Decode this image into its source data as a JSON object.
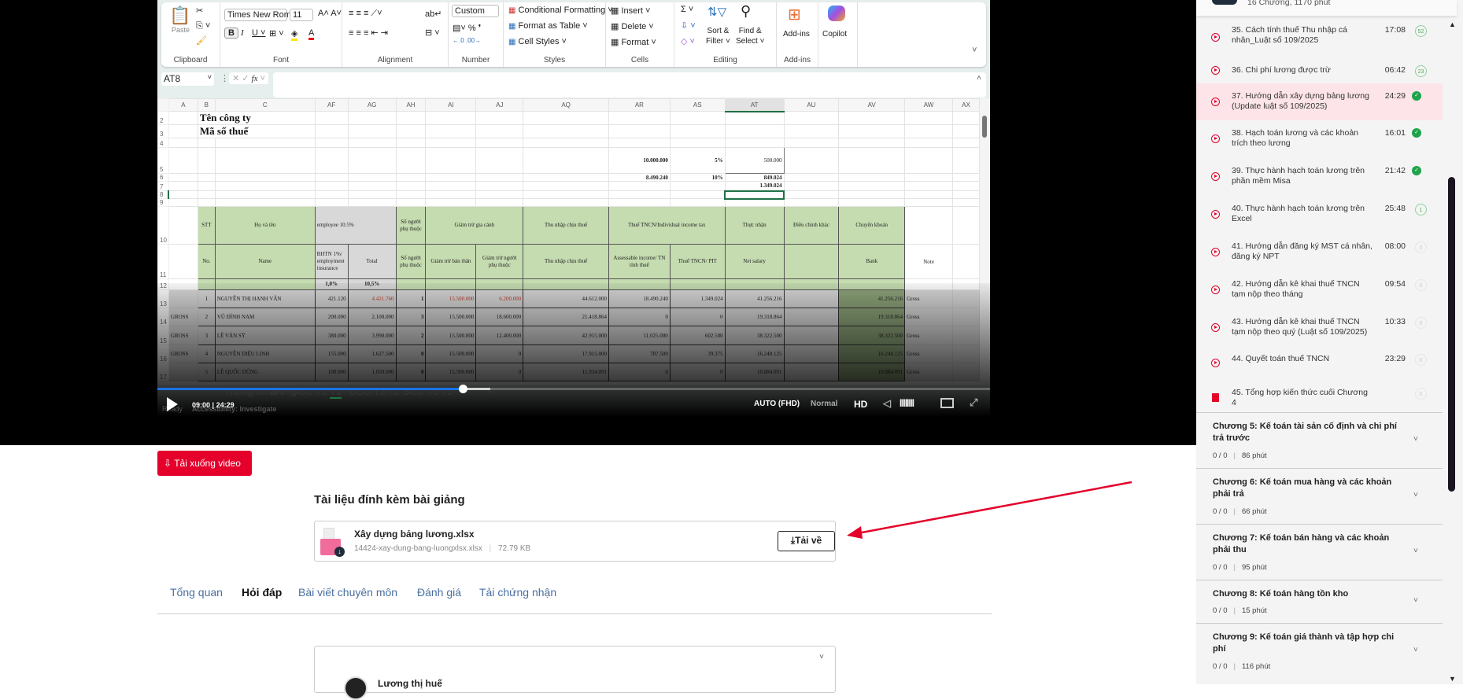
{
  "excel": {
    "font_name": "Times New Roman",
    "font_size": "11",
    "number_format": "Custom",
    "clipboard": {
      "paste": "Paste",
      "label": "Clipboard"
    },
    "font_label": "Font",
    "alignment_label": "Alignment",
    "number_label": "Number",
    "styles": {
      "conditional": "Conditional Formatting",
      "format_table": "Format as Table",
      "cell_styles": "Cell Styles",
      "label": "Styles"
    },
    "cells": {
      "insert": "Insert",
      "delete": "Delete",
      "format": "Format",
      "label": "Cells"
    },
    "editing": {
      "sort": "Sort &",
      "filter": "Filter",
      "find": "Find &",
      "select": "Select",
      "label": "Editing"
    },
    "addins": {
      "button": "Add-ins",
      "label": "Add-ins"
    },
    "copilot": "Copilot",
    "name_box": "AT8",
    "fx": "fx",
    "columns": [
      "A",
      "B",
      "C",
      "AF",
      "AG",
      "AH",
      "AI",
      "AJ",
      "AQ",
      "AR",
      "AS",
      "AT",
      "AU",
      "AV",
      "AW",
      "AX"
    ],
    "rows": [
      {
        "n": "2",
        "cells": {
          "B": {
            "t": "Tên công ty",
            "c": "big",
            "span": 2
          }
        }
      },
      {
        "n": "3",
        "cells": {
          "B": {
            "t": "Mã số thuế",
            "c": "big",
            "span": 2
          }
        }
      },
      {
        "n": "4",
        "cells": {}
      },
      {
        "n": "5",
        "cells": {
          "AR": {
            "t": "10.000.000",
            "c": "r b"
          },
          "AS": {
            "t": "5%",
            "c": "r b"
          },
          "AT": {
            "t": "500.000",
            "c": "r box5"
          }
        }
      },
      {
        "n": "6",
        "cells": {
          "AR": {
            "t": "8.490.240",
            "c": "r b"
          },
          "AS": {
            "t": "10%",
            "c": "r b"
          },
          "AT": {
            "t": "849.024",
            "c": "r b"
          }
        }
      },
      {
        "n": "7",
        "cells": {
          "AT": {
            "t": "1.349.024",
            "c": "r b"
          }
        }
      },
      {
        "n": "8",
        "cells": {
          "AT": {
            "t": "",
            "c": "sel8"
          }
        }
      },
      {
        "n": "9",
        "cells": {}
      },
      {
        "n": "10",
        "cells": {
          "B": {
            "t": "STT",
            "c": "g"
          },
          "C": {
            "t": "Họ và tên",
            "c": "g"
          },
          "AF": {
            "t": "employee 10.5%",
            "c": "gy",
            "span": 2
          },
          "AH": {
            "t": "Số người phụ thuộc",
            "c": "g"
          },
          "AI": {
            "t": "Giảm trừ gia cảnh",
            "c": "g",
            "span": 2
          },
          "AQ": {
            "t": "Thu nhập chịu thuế",
            "c": "g"
          },
          "AR": {
            "t": "Thuế TNCN/Individual income tax",
            "c": "g",
            "span": 2
          },
          "AT": {
            "t": "Thực nhận",
            "c": "g"
          },
          "AU": {
            "t": "Điều chỉnh khác",
            "c": "g"
          },
          "AV": {
            "t": "Chuyển khoản",
            "c": "g"
          }
        }
      },
      {
        "n": "11",
        "cells": {
          "B": {
            "t": "No.",
            "c": "g"
          },
          "C": {
            "t": "Name",
            "c": "g"
          },
          "AF": {
            "t": "BHTN 1%/ employment insurance",
            "c": "gy"
          },
          "AG": {
            "t": "Total",
            "c": "gy c"
          },
          "AH": {
            "t": "Số người phụ thuộc",
            "c": "g"
          },
          "AI": {
            "t": "Giảm trừ bản thân",
            "c": "g"
          },
          "AJ": {
            "t": "Giảm trừ người phụ thuộc",
            "c": "g"
          },
          "AQ": {
            "t": "Thu nhập chịu thuế",
            "c": "g"
          },
          "AR": {
            "t": "Assessable income/ TN tính thuế",
            "c": "g"
          },
          "AS": {
            "t": "Thuế TNCN/ PIT",
            "c": "g"
          },
          "AT": {
            "t": "Net salary",
            "c": "g"
          },
          "AU": {
            "t": "",
            "c": "g"
          },
          "AV": {
            "t": "Bank",
            "c": "g"
          },
          "AW": {
            "t": "Note",
            "c": "c"
          }
        }
      },
      {
        "n": "12",
        "cells": {
          "B": {
            "t": "",
            "c": "g"
          },
          "C": {
            "t": "",
            "c": "g"
          },
          "AF": {
            "t": "1,0%",
            "c": "gy c b"
          },
          "AG": {
            "t": "10,5%",
            "c": "gy c b"
          },
          "AH": {
            "t": "",
            "c": "g"
          },
          "AI": {
            "t": "",
            "c": "g"
          },
          "AJ": {
            "t": "",
            "c": "g"
          },
          "AQ": {
            "t": "",
            "c": "g"
          },
          "AR": {
            "t": "",
            "c": "g"
          },
          "AS": {
            "t": "",
            "c": "g"
          },
          "AT": {
            "t": "",
            "c": "g"
          },
          "AU": {
            "t": "",
            "c": "g"
          },
          "AV": {
            "t": "",
            "c": "g"
          }
        }
      },
      {
        "n": "13",
        "data": true,
        "cells": {
          "A": {
            "t": ""
          },
          "B": {
            "t": "1"
          },
          "C": {
            "t": "NGUYỄN THỊ HẠNH VÂN"
          },
          "AF": {
            "t": "421.120"
          },
          "AG": {
            "t": "4.421.760",
            "c": "red"
          },
          "AH": {
            "t": "1"
          },
          "AI": {
            "t": "15.500.000",
            "c": "red"
          },
          "AJ": {
            "t": "6.200.000",
            "c": "red"
          },
          "AQ": {
            "t": "44.612.000"
          },
          "AR": {
            "t": "18.490.240"
          },
          "AS": {
            "t": "1.349.024"
          },
          "AT": {
            "t": "41.256.216"
          },
          "AU": {
            "t": ""
          },
          "AV": {
            "t": "41.256.216"
          },
          "AW": {
            "t": "Gross"
          }
        }
      },
      {
        "n": "14",
        "data": true,
        "cells": {
          "A": {
            "t": "GROSS"
          },
          "B": {
            "t": "2"
          },
          "C": {
            "t": "VŨ ĐÌNH NAM"
          },
          "AF": {
            "t": "200.000"
          },
          "AG": {
            "t": "2.100.000"
          },
          "AH": {
            "t": "3"
          },
          "AI": {
            "t": "15.500.000"
          },
          "AJ": {
            "t": "18.600.000"
          },
          "AQ": {
            "t": "21.418.864"
          },
          "AR": {
            "t": "0"
          },
          "AS": {
            "t": "0"
          },
          "AT": {
            "t": "19.318.864"
          },
          "AU": {
            "t": ""
          },
          "AV": {
            "t": "19.318.864"
          },
          "AW": {
            "t": "Gross"
          }
        }
      },
      {
        "n": "15",
        "data": true,
        "cells": {
          "A": {
            "t": "GROSS"
          },
          "B": {
            "t": "3"
          },
          "C": {
            "t": "LÊ VĂN SỸ"
          },
          "AF": {
            "t": "380.000"
          },
          "AG": {
            "t": "3.990.000"
          },
          "AH": {
            "t": "2"
          },
          "AI": {
            "t": "15.500.000"
          },
          "AJ": {
            "t": "12.400.000"
          },
          "AQ": {
            "t": "42.915.000"
          },
          "AR": {
            "t": "11.025.000"
          },
          "AS": {
            "t": "602.500"
          },
          "AT": {
            "t": "38.322.500"
          },
          "AU": {
            "t": ""
          },
          "AV": {
            "t": "38.322.500"
          },
          "AW": {
            "t": "Gross"
          }
        }
      },
      {
        "n": "16",
        "data": true,
        "cells": {
          "A": {
            "t": "GROSS"
          },
          "B": {
            "t": "4"
          },
          "C": {
            "t": "NGUYỄN DIỆU LINH"
          },
          "AF": {
            "t": "155.000"
          },
          "AG": {
            "t": "1.627.500"
          },
          "AH": {
            "t": "0"
          },
          "AI": {
            "t": "15.500.000"
          },
          "AJ": {
            "t": "0"
          },
          "AQ": {
            "t": "17.915.000"
          },
          "AR": {
            "t": "787.500"
          },
          "AS": {
            "t": "39.375"
          },
          "AT": {
            "t": "16.248.125"
          },
          "AU": {
            "t": ""
          },
          "AV": {
            "t": "16.248.125"
          },
          "AW": {
            "t": "Gross"
          }
        }
      },
      {
        "n": "17",
        "data": true,
        "cells": {
          "A": {
            "t": ""
          },
          "B": {
            "t": "5"
          },
          "C": {
            "t": "LÊ QUỐC DŨNG"
          },
          "AF": {
            "t": "100.000"
          },
          "AG": {
            "t": "1.050.000"
          },
          "AH": {
            "t": "0"
          },
          "AI": {
            "t": "15.500.000"
          },
          "AJ": {
            "t": "0"
          },
          "AQ": {
            "t": "11.934.091"
          },
          "AR": {
            "t": "0"
          },
          "AS": {
            "t": "0"
          },
          "AT": {
            "t": "10.884.091"
          },
          "AU": {
            "t": ""
          },
          "AV": {
            "t": "10.884.091"
          },
          "AW": {
            "t": "Gross"
          }
        }
      }
    ],
    "sheet_tabs": [
      "Thông tin lương",
      "BH",
      "BCC T1",
      "T1",
      "BCC T2",
      "T2",
      "BCC T3",
      "T3",
      "+"
    ],
    "active_sheet": "T1",
    "status": "Ready",
    "accessibility": "Accessibility: Investigate"
  },
  "player": {
    "current": "09:00",
    "separator": "|",
    "duration": "24:29",
    "progress": 0.367,
    "buffered": 0.4,
    "quality": "AUTO (FHD)",
    "speed": "Normal",
    "hd": "HD"
  },
  "main": {
    "download_video": "Tải xuống video",
    "attachments_title": "Tài liệu đính kèm bài giảng",
    "file": {
      "name": "Xây dựng bảng lương.xlsx",
      "filename": "14424-xay-dung-bang-luongxlsx.xlsx",
      "size": "72.79 KB",
      "download": "Tải về"
    },
    "tabs": [
      "Tổng quan",
      "Hỏi đáp",
      "Bài viết chuyên môn",
      "Đánh giá",
      "Tải chứng nhận"
    ],
    "active_tab": "Hỏi đáp",
    "comment_author": "Lương thị huế",
    "accent": "#e4002b"
  },
  "sidebar": {
    "summary": "16 Chương, 1170 phút",
    "lessons": [
      {
        "title": "35. Cách tính thuế Thu nhập cá nhân_Luật số 109/2025",
        "duration": "17:08",
        "status": "52"
      },
      {
        "title": "36. Chi phí lương được trừ",
        "duration": "06:42",
        "status": "23"
      },
      {
        "title": "37. Hướng dẫn xây dựng bảng lương (Update luật số 109/2025)",
        "duration": "24:29",
        "status": "done"
      },
      {
        "title": "38. Hạch toán lương và các khoản trích theo lương",
        "duration": "16:01",
        "status": "done"
      },
      {
        "title": "39. Thực hành hạch toán lương trên phần mềm Misa",
        "duration": "21:42",
        "status": "done"
      },
      {
        "title": "40. Thực hành hạch toán lương trên Excel",
        "duration": "25:48",
        "status": "1"
      },
      {
        "title": "41. Hướng dẫn đăng ký MST cá nhân, đăng ký NPT",
        "duration": "08:00",
        "status": "0"
      },
      {
        "title": "42. Hướng dẫn kê khai thuế TNCN tạm nộp theo tháng",
        "duration": "09:54",
        "status": "0"
      },
      {
        "title": "43. Hướng dẫn kê khai thuế TNCN tạm nộp theo quý (Luật số 109/2025)",
        "duration": "10:33",
        "status": "0"
      },
      {
        "title": "44. Quyết toán thuế TNCN",
        "duration": "23:29",
        "status": "0"
      },
      {
        "title": "45. Tổng hợp kiến thức cuối Chương 4",
        "duration": "",
        "status": "0"
      }
    ],
    "chapters": [
      {
        "title": "Chương 5: Kế toán tài sản cố định và chi phí trả trước",
        "progress": "0 / 0",
        "minutes": "86 phút"
      },
      {
        "title": "Chương 6: Kế toán mua hàng và các khoản phải trả",
        "progress": "0 / 0",
        "minutes": "66 phút"
      },
      {
        "title": "Chương 7: Kế toán bán hàng và các khoản phải thu",
        "progress": "0 / 0",
        "minutes": "95 phút"
      },
      {
        "title": "Chương 8: Kế toán hàng tồn kho",
        "progress": "0 / 0",
        "minutes": "15 phút"
      },
      {
        "title": "Chương 9: Kế toán giá thành và tập hợp chi phí",
        "progress": "0 / 0",
        "minutes": "116 phút"
      }
    ]
  }
}
